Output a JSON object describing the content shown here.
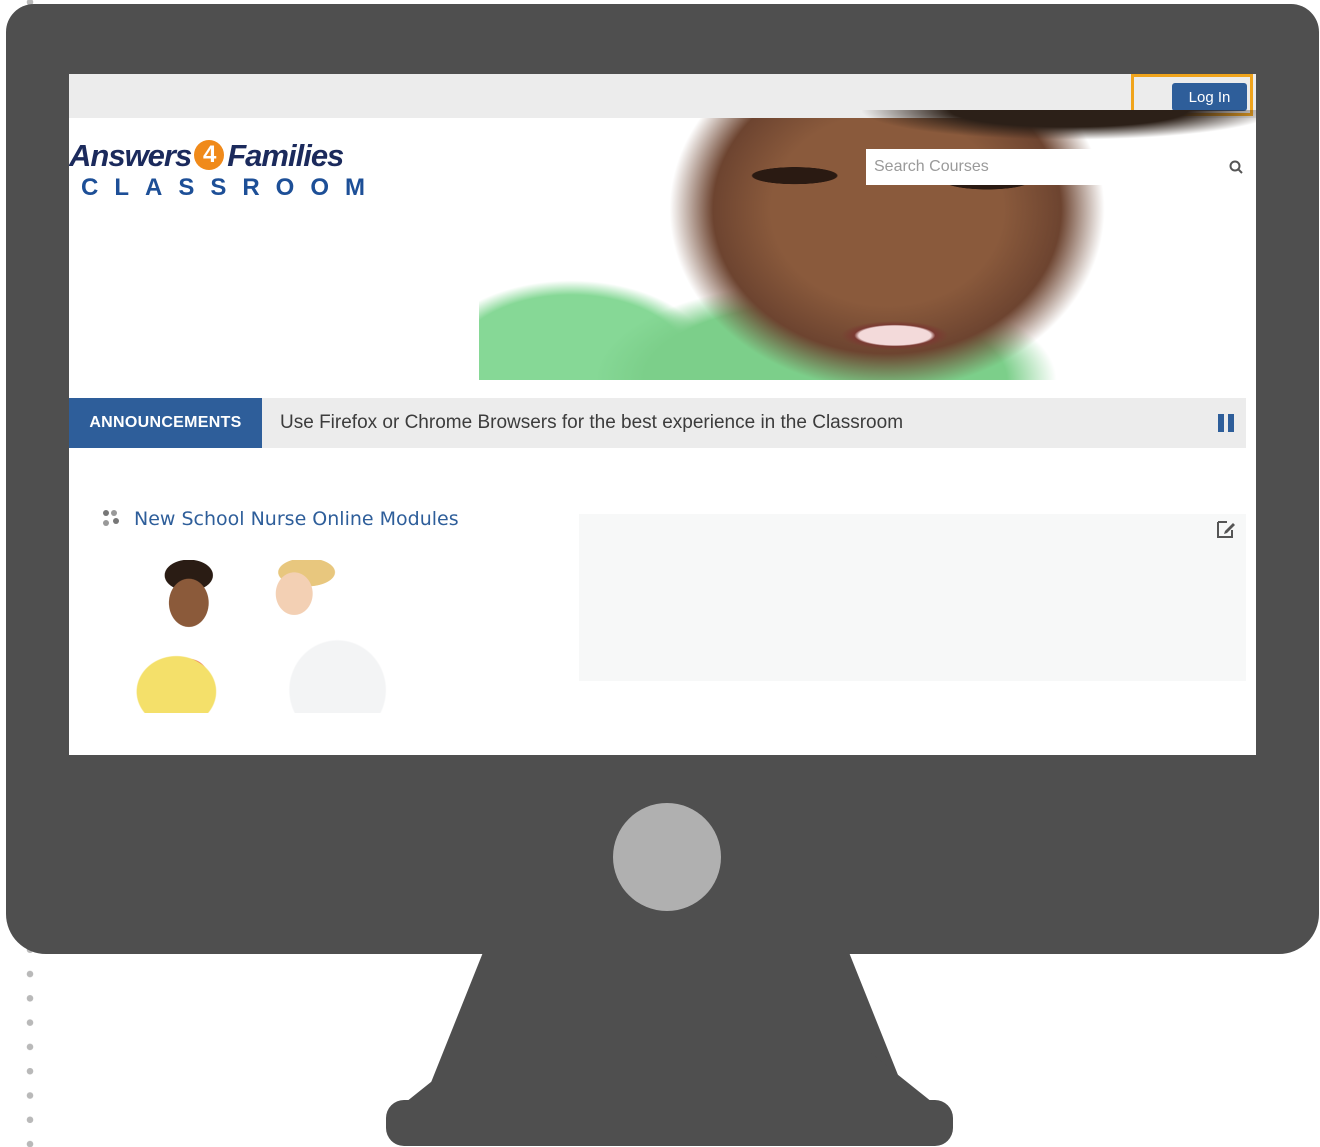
{
  "header": {
    "login_label": "Log In"
  },
  "logo": {
    "main_before": "Answers",
    "main_number": "4",
    "main_after": "Families",
    "sub": "CLASSROOM"
  },
  "search": {
    "placeholder": "Search Courses"
  },
  "announcements": {
    "label": "ANNOUNCEMENTS",
    "text": "Use Firefox or Chrome Browsers for the best experience in the Classroom"
  },
  "course": {
    "title": "New School Nurse Online Modules"
  },
  "colors": {
    "brand_blue": "#2e5e9a",
    "highlight": "#f0a41c",
    "monitor": "#4f4f4f"
  }
}
